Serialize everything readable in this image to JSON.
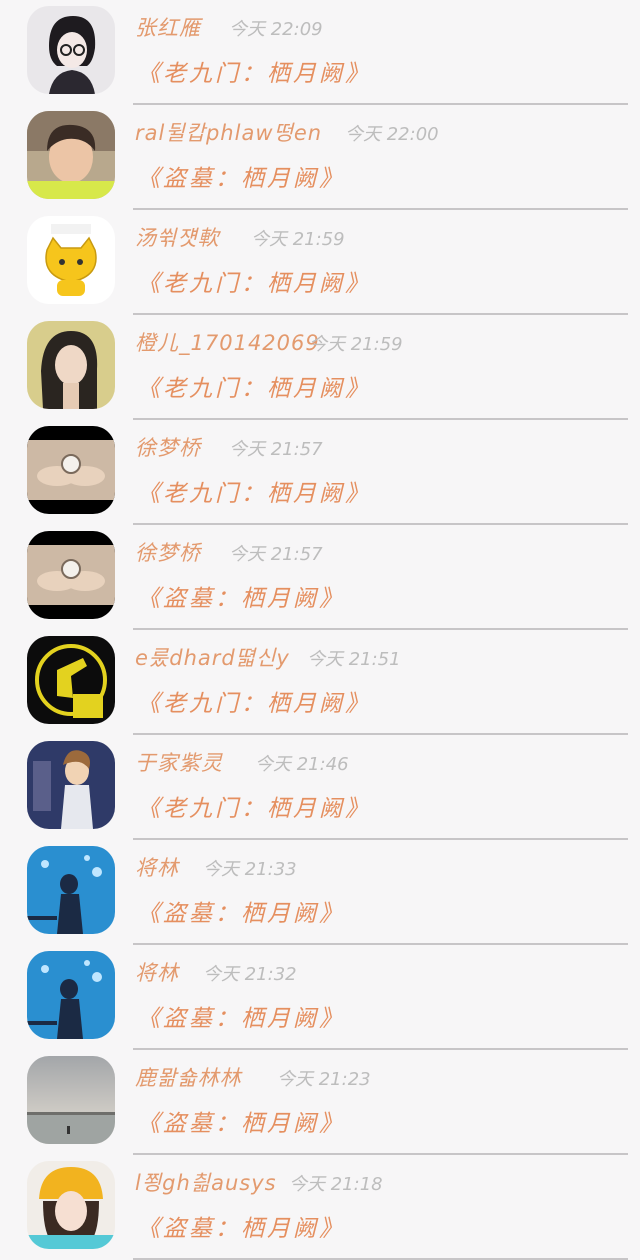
{
  "comments": [
    {
      "name": "张红雁",
      "time": "今天 22:09",
      "novel": "《老九门：栖月阙》",
      "avatar_icon": "girl-glasses-avatar-icon"
    },
    {
      "name": "ral뒬캅phlaw떵en",
      "time": "今天 22:00",
      "novel": "《盗墓：栖月阙》",
      "avatar_icon": "boy-portrait-avatar-icon"
    },
    {
      "name": "汤쒺쟷軟",
      "time": "今天 21:59",
      "novel": "《老九门：栖月阙》",
      "avatar_icon": "yellow-cartoon-cat-avatar-icon"
    },
    {
      "name": "橙儿_170142069",
      "time": "今天 21:59",
      "novel": "《老九门：栖月阙》",
      "avatar_icon": "woman-portrait-avatar-icon"
    },
    {
      "name": "徐梦桥",
      "time": "今天 21:57",
      "novel": "《老九门：栖月阙》",
      "avatar_icon": "pocket-watch-hands-avatar-icon"
    },
    {
      "name": "徐梦桥",
      "time": "今天 21:57",
      "novel": "《盗墓：栖月阙》",
      "avatar_icon": "pocket-watch-hands-avatar-icon"
    },
    {
      "name": "e룼dhard뗣신y",
      "time": "今天 21:51",
      "novel": "《老九门：栖月阙》",
      "avatar_icon": "we-are-one-fist-avatar-icon"
    },
    {
      "name": "于家紫灵",
      "time": "今天 21:46",
      "novel": "《老九门：栖月阙》",
      "avatar_icon": "anime-boy-avatar-icon"
    },
    {
      "name": "将林",
      "time": "今天 21:33",
      "novel": "《盗墓：栖月阙》",
      "avatar_icon": "blue-bubbles-boy-avatar-icon"
    },
    {
      "name": "将林",
      "time": "今天 21:32",
      "novel": "《盗墓：栖月阙》",
      "avatar_icon": "blue-bubbles-boy-avatar-icon"
    },
    {
      "name": "鹿뫎숇林林",
      "time": "今天 21:23",
      "novel": "《盗墓：栖月阙》",
      "avatar_icon": "lake-landscape-avatar-icon"
    },
    {
      "name": "l쬥gh칆ausys",
      "time": "今天 21:18",
      "novel": "《盗墓：栖月阙》",
      "avatar_icon": "girl-yellow-hat-avatar-icon"
    }
  ]
}
